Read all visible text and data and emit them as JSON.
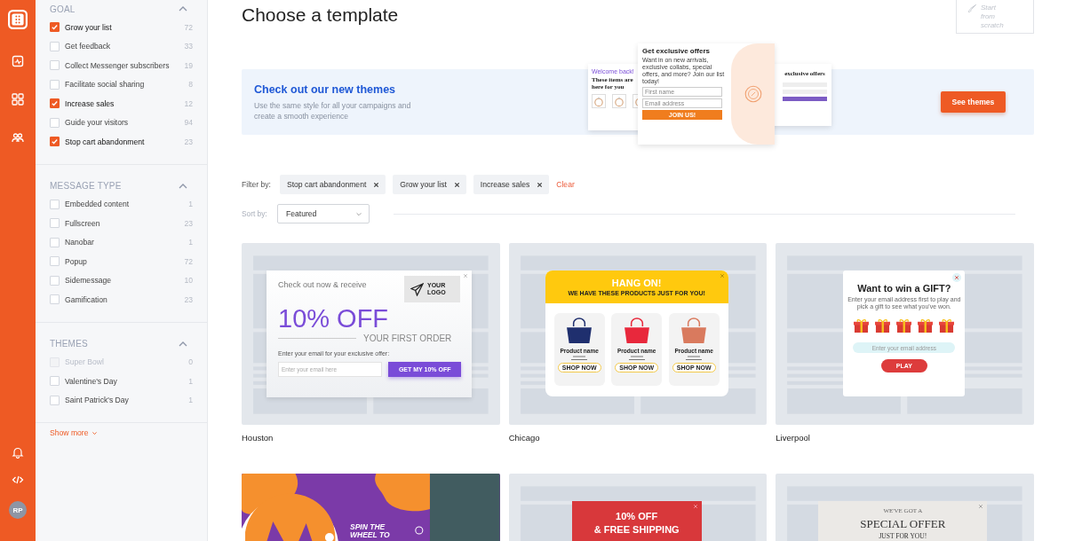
{
  "rail": {
    "avatar": "RP"
  },
  "filters": [
    {
      "title": "GOAL",
      "expanded": true,
      "items": [
        {
          "label": "Grow your list",
          "count": "72",
          "checked": true,
          "disabled": false
        },
        {
          "label": "Get feedback",
          "count": "33",
          "checked": false,
          "disabled": false
        },
        {
          "label": "Collect Messenger subscribers",
          "count": "19",
          "checked": false,
          "disabled": false
        },
        {
          "label": "Facilitate social sharing",
          "count": "8",
          "checked": false,
          "disabled": false
        },
        {
          "label": "Increase sales",
          "count": "12",
          "checked": true,
          "disabled": false
        },
        {
          "label": "Guide your visitors",
          "count": "94",
          "checked": false,
          "disabled": false
        },
        {
          "label": "Stop cart abandonment",
          "count": "23",
          "checked": true,
          "disabled": false
        }
      ]
    },
    {
      "title": "MESSAGE TYPE",
      "expanded": true,
      "items": [
        {
          "label": "Embedded content",
          "count": "1",
          "checked": false,
          "disabled": false
        },
        {
          "label": "Fullscreen",
          "count": "23",
          "checked": false,
          "disabled": false
        },
        {
          "label": "Nanobar",
          "count": "1",
          "checked": false,
          "disabled": false
        },
        {
          "label": "Popup",
          "count": "72",
          "checked": false,
          "disabled": false
        },
        {
          "label": "Sidemessage",
          "count": "10",
          "checked": false,
          "disabled": false
        },
        {
          "label": "Gamification",
          "count": "23",
          "checked": false,
          "disabled": false
        }
      ]
    },
    {
      "title": "THEMES",
      "expanded": true,
      "items": [
        {
          "label": "Super Bowl",
          "count": "0",
          "checked": false,
          "disabled": true
        },
        {
          "label": "Valentine's Day",
          "count": "1",
          "checked": false,
          "disabled": false
        },
        {
          "label": "Saint Patrick's Day",
          "count": "1",
          "checked": false,
          "disabled": false
        }
      ]
    }
  ],
  "show_more": "Show more",
  "page_title": "Choose a template",
  "start_button": {
    "label": "Start from scratch",
    "disabled": true
  },
  "banner": {
    "title": "Check out our new themes",
    "text": "Use the same style for all your campaigns and create a smooth experience",
    "button": "See themes",
    "preview_left": {
      "greeting": "Welcome back!",
      "heading": "These items are here for you"
    },
    "preview_middle": {
      "heading": "Get exclusive offers",
      "text": "Want in on new arrivals, exclusive collabs, special offers, and more? Join our list today!",
      "field_1": "First name",
      "field_2": "Email address",
      "button": "JOIN US!"
    },
    "preview_right": {
      "heading": "exclusive offers"
    }
  },
  "filter_bar": {
    "label": "Filter by:",
    "chips": [
      "Stop cart abandonment",
      "Grow your list",
      "Increase sales"
    ],
    "clear": "Clear"
  },
  "sort": {
    "label": "Sort by:",
    "value": "Featured"
  },
  "templates": [
    {
      "kind": "houston",
      "name": "Houston",
      "intro": "Check out now & receive",
      "logo": "YOUR LOGO",
      "offer": "10% OFF",
      "subline": "YOUR FIRST ORDER",
      "prompt": "Enter your email for your exclusive offer:",
      "placeholder": "Enter your email here",
      "button": "GET MY 10% OFF"
    },
    {
      "kind": "chicago",
      "name": "Chicago",
      "heading": "HANG ON!",
      "subheading": "WE HAVE THESE PRODUCTS JUST FOR YOU!",
      "products": [
        {
          "name": "Product name",
          "button": "SHOP NOW",
          "color": "#1f2f6e"
        },
        {
          "name": "Product name",
          "button": "SHOP NOW",
          "color": "#e8283c"
        },
        {
          "name": "Product name",
          "button": "SHOP NOW",
          "color": "#d97a5e"
        }
      ]
    },
    {
      "kind": "liverpool",
      "name": "Liverpool",
      "heading": "Want to win a GIFT?",
      "text": "Enter your email address first to play and pick a gift to see what you've won.",
      "placeholder": "Enter your email address",
      "button": "PLAY"
    },
    {
      "kind": "wheel",
      "heading": "SPIN THE WHEEL TO"
    },
    {
      "kind": "shipping",
      "heading": "10% OFF",
      "subheading": "& FREE SHIPPING"
    },
    {
      "kind": "special",
      "kicker": "WE'VE GOT A",
      "heading": "SPECIAL OFFER",
      "subheading": "JUST FOR YOU!"
    }
  ]
}
